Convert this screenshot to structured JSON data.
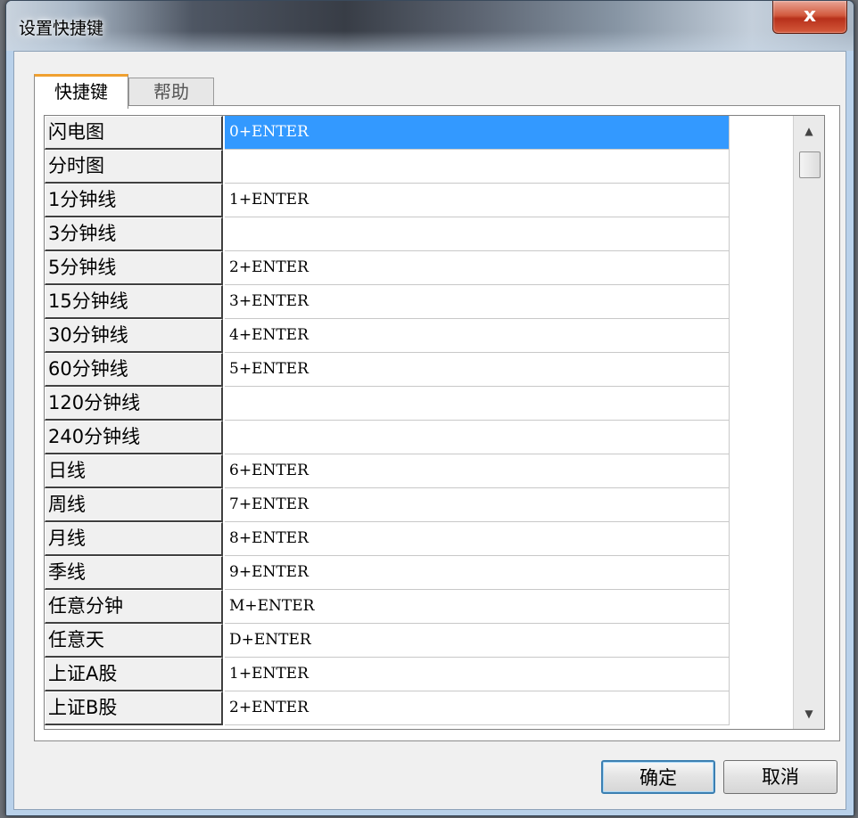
{
  "window": {
    "title": "设置快捷键",
    "close_label": "x"
  },
  "tabs": [
    {
      "label": "快捷键"
    },
    {
      "label": "帮助"
    }
  ],
  "grid": {
    "rows": [
      {
        "label": "闪电图",
        "key": "0+ENTER",
        "selected": true
      },
      {
        "label": "分时图",
        "key": ""
      },
      {
        "label": "1分钟线",
        "key": "1+ENTER"
      },
      {
        "label": "3分钟线",
        "key": ""
      },
      {
        "label": "5分钟线",
        "key": "2+ENTER"
      },
      {
        "label": "15分钟线",
        "key": "3+ENTER"
      },
      {
        "label": "30分钟线",
        "key": "4+ENTER"
      },
      {
        "label": "60分钟线",
        "key": "5+ENTER"
      },
      {
        "label": "120分钟线",
        "key": ""
      },
      {
        "label": "240分钟线",
        "key": ""
      },
      {
        "label": "日线",
        "key": "6+ENTER"
      },
      {
        "label": "周线",
        "key": "7+ENTER"
      },
      {
        "label": "月线",
        "key": "8+ENTER"
      },
      {
        "label": "季线",
        "key": "9+ENTER"
      },
      {
        "label": "任意分钟",
        "key": "M+ENTER"
      },
      {
        "label": "任意天",
        "key": "D+ENTER"
      },
      {
        "label": "上证A股",
        "key": "1+ENTER"
      },
      {
        "label": "上证B股",
        "key": "2+ENTER"
      }
    ]
  },
  "scrollbar": {
    "up_icon": "scroll-up-arrow",
    "down_icon": "scroll-down-arrow"
  },
  "buttons": {
    "ok_label": "确定",
    "cancel_label": "取消"
  },
  "colors": {
    "selection": "#3399ff",
    "tab_accent": "#f0a030"
  }
}
